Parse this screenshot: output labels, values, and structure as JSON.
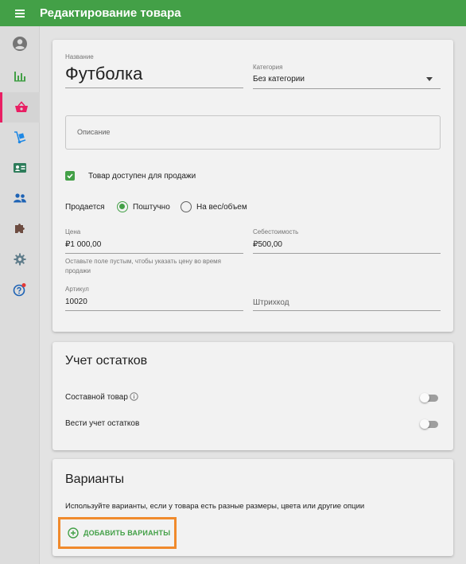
{
  "header": {
    "title": "Редактирование товара"
  },
  "sidebar": {
    "items": [
      {
        "icon": "account-circle-icon"
      },
      {
        "icon": "bar-chart-icon"
      },
      {
        "icon": "basket-icon",
        "active": true
      },
      {
        "icon": "hand-truck-icon"
      },
      {
        "icon": "id-card-icon"
      },
      {
        "icon": "people-icon"
      },
      {
        "icon": "puzzle-icon"
      },
      {
        "icon": "gear-icon"
      },
      {
        "icon": "help-icon"
      }
    ]
  },
  "product": {
    "name_label": "Название",
    "name_value": "Футболка",
    "category_label": "Категория",
    "category_value": "Без категории",
    "description_placeholder": "Описание",
    "available_label": "Товар доступен для продажи",
    "available_checked": true,
    "sold_label": "Продается",
    "sold_option_piece": "Поштучно",
    "sold_option_weight": "На вес/объем",
    "sold_selected": "Поштучно",
    "price_label": "Цена",
    "price_value": "₽1 000,00",
    "price_hint_1": "Оставьте поле пустым, чтобы указать цену во время",
    "price_hint_2": "продажи",
    "cost_label": "Себестоимость",
    "cost_value": "₽500,00",
    "sku_label": "Артикул",
    "sku_value": "10020",
    "barcode_placeholder": "Штрихкод"
  },
  "stock": {
    "title": "Учет остатков",
    "composite_label": "Составной товар",
    "composite_on": false,
    "track_label": "Вести учет остатков",
    "track_on": false
  },
  "variants": {
    "title": "Варианты",
    "description": "Используйте варианты, если у товара есть разные размеры, цвета или другие опции",
    "add_button": "ДОБАВИТЬ ВАРИАНТЫ"
  },
  "colors": {
    "primary_green": "#43a047",
    "active_accent": "#e91e63",
    "highlight_orange": "#f08a2c"
  }
}
